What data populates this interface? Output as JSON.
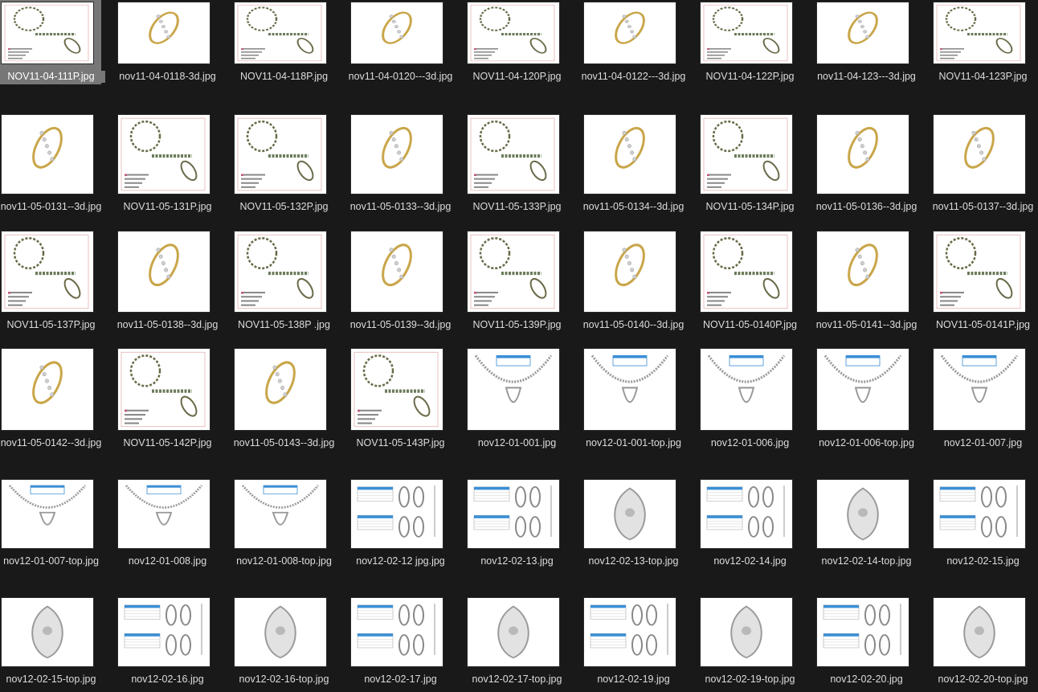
{
  "explorer": {
    "view": "large-icons",
    "selected_file": "NOV11-04-111P.jpg",
    "rows": [
      [
        {
          "name": "NOV11-04-111P.jpg",
          "kind": "sheet"
        },
        {
          "name": "nov11-04-0118-3d.jpg",
          "kind": "ring"
        },
        {
          "name": "NOV11-04-118P.jpg",
          "kind": "sheet"
        },
        {
          "name": "nov11-04-0120---3d.jpg",
          "kind": "ring"
        },
        {
          "name": "NOV11-04-120P.jpg",
          "kind": "sheet"
        },
        {
          "name": "nov11-04-0122---3d.jpg",
          "kind": "ring"
        },
        {
          "name": "NOV11-04-122P.jpg",
          "kind": "sheet"
        },
        {
          "name": "nov11-04-123---3d.jpg",
          "kind": "ring"
        },
        {
          "name": "NOV11-04-123P.jpg",
          "kind": "sheet"
        }
      ],
      [
        {
          "name": "nov11-05-0131--3d.jpg",
          "kind": "ring"
        },
        {
          "name": "NOV11-05-131P.jpg",
          "kind": "sheet"
        },
        {
          "name": "NOV11-05-132P.jpg",
          "kind": "sheet"
        },
        {
          "name": "nov11-05-0133--3d.jpg",
          "kind": "ring"
        },
        {
          "name": "NOV11-05-133P.jpg",
          "kind": "sheet"
        },
        {
          "name": "nov11-05-0134--3d.jpg",
          "kind": "ring"
        },
        {
          "name": "NOV11-05-134P.jpg",
          "kind": "sheet"
        },
        {
          "name": "nov11-05-0136--3d.jpg",
          "kind": "ring"
        },
        {
          "name": "nov11-05-0137--3d.jpg",
          "kind": "ring"
        }
      ],
      [
        {
          "name": "NOV11-05-137P.jpg",
          "kind": "sheet"
        },
        {
          "name": "nov11-05-0138--3d.jpg",
          "kind": "ring"
        },
        {
          "name": "NOV11-05-138P .jpg",
          "kind": "sheet"
        },
        {
          "name": "nov11-05-0139--3d.jpg",
          "kind": "ring"
        },
        {
          "name": "NOV11-05-139P.jpg",
          "kind": "sheet"
        },
        {
          "name": "nov11-05-0140--3d.jpg",
          "kind": "ring"
        },
        {
          "name": "NOV11-05-0140P.jpg",
          "kind": "sheet"
        },
        {
          "name": "nov11-05-0141--3d.jpg",
          "kind": "ring"
        },
        {
          "name": "NOV11-05-0141P.jpg",
          "kind": "sheet"
        }
      ],
      [
        {
          "name": "nov11-05-0142--3d.jpg",
          "kind": "ring"
        },
        {
          "name": "NOV11-05-142P.jpg",
          "kind": "sheet"
        },
        {
          "name": "nov11-05-0143--3d.jpg",
          "kind": "ring"
        },
        {
          "name": "NOV11-05-143P.jpg",
          "kind": "sheet"
        },
        {
          "name": "nov12-01-001.jpg",
          "kind": "necklace"
        },
        {
          "name": "nov12-01-001-top.jpg",
          "kind": "necklace"
        },
        {
          "name": "nov12-01-006.jpg",
          "kind": "necklace"
        },
        {
          "name": "nov12-01-006-top.jpg",
          "kind": "necklace"
        },
        {
          "name": "nov12-01-007.jpg",
          "kind": "necklace"
        }
      ],
      [
        {
          "name": "nov12-01-007-top.jpg",
          "kind": "necklace"
        },
        {
          "name": "nov12-01-008.jpg",
          "kind": "necklace"
        },
        {
          "name": "nov12-01-008-top.jpg",
          "kind": "necklace"
        },
        {
          "name": "nov12-02-12 jpg.jpg",
          "kind": "pendant-sheet"
        },
        {
          "name": "nov12-02-13.jpg",
          "kind": "pendant-sheet"
        },
        {
          "name": "nov12-02-13-top.jpg",
          "kind": "pendant"
        },
        {
          "name": "nov12-02-14.jpg",
          "kind": "pendant-sheet"
        },
        {
          "name": "nov12-02-14-top.jpg",
          "kind": "pendant"
        },
        {
          "name": "nov12-02-15.jpg",
          "kind": "pendant-sheet"
        }
      ],
      [
        {
          "name": "nov12-02-15-top.jpg",
          "kind": "pendant"
        },
        {
          "name": "nov12-02-16.jpg",
          "kind": "pendant-sheet"
        },
        {
          "name": "nov12-02-16-top.jpg",
          "kind": "pendant"
        },
        {
          "name": "nov12-02-17.jpg",
          "kind": "pendant-sheet"
        },
        {
          "name": "nov12-02-17-top.jpg",
          "kind": "pendant"
        },
        {
          "name": "nov12-02-19.jpg",
          "kind": "pendant-sheet"
        },
        {
          "name": "nov12-02-19-top.jpg",
          "kind": "pendant"
        },
        {
          "name": "nov12-02-20.jpg",
          "kind": "pendant-sheet"
        },
        {
          "name": "nov12-02-20-top.jpg",
          "kind": "pendant"
        }
      ]
    ]
  },
  "colors": {
    "background": "#191919",
    "label_text": "#dcdcdc",
    "selection": "#777777",
    "gold": "#c9a64a",
    "diamond": "#cfcfcf",
    "table_header": "#3b8fd6"
  }
}
